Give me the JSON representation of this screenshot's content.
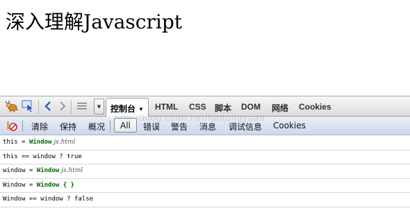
{
  "page": {
    "heading": "深入理解Javascript"
  },
  "toolbar": {
    "icons": [
      "firebug-bug-icon",
      "inspect-cursor-icon",
      "back-chevron-icon",
      "forward-chevron-icon",
      "menu-lines-icon",
      "dropdown-arrow-icon"
    ],
    "tabs": [
      {
        "label": "控制台",
        "active": true
      },
      {
        "label": "HTML"
      },
      {
        "label": "CSS"
      },
      {
        "label": "脚本"
      },
      {
        "label": "DOM"
      },
      {
        "label": "网络"
      },
      {
        "label": "Cookies"
      }
    ]
  },
  "console_bar": {
    "items": [
      "清除",
      "保持",
      "概况",
      "All",
      "错误",
      "警告",
      "消息",
      "调试信息",
      "Cookies"
    ],
    "active": "All"
  },
  "watermark": "http://blog.csdn.net/luotongyuan",
  "log": [
    {
      "prefix": "this = ",
      "object": "Window",
      "suffix": " js.html"
    },
    {
      "text": "this == window ? true"
    },
    {
      "prefix": "window = ",
      "object": "Window",
      "suffix": " js.html"
    },
    {
      "prefix": "Window = ",
      "object": "Window { }",
      "suffix": ""
    },
    {
      "text": "Window == window ? false"
    }
  ]
}
